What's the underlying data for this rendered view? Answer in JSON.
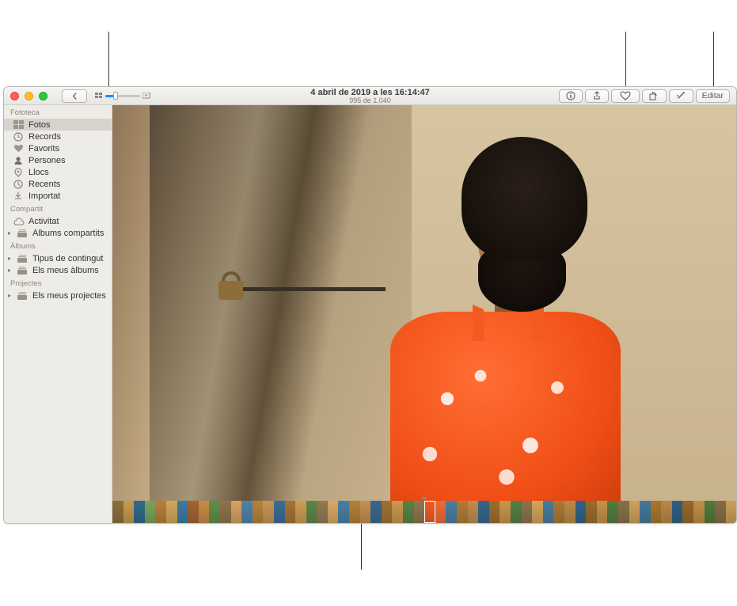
{
  "header": {
    "title": "4 abril de 2019 a les 16:14:47",
    "subtitle": "995 de 1.040",
    "edit_label": "Editar"
  },
  "sidebar": {
    "sections": [
      {
        "title": "Fototeca",
        "items": [
          {
            "label": "Fotos",
            "icon": "photos-icon",
            "selected": true
          },
          {
            "label": "Records",
            "icon": "memories-icon"
          },
          {
            "label": "Favorits",
            "icon": "heart-icon"
          },
          {
            "label": "Persones",
            "icon": "people-icon"
          },
          {
            "label": "Llocs",
            "icon": "places-icon"
          },
          {
            "label": "Recents",
            "icon": "recents-icon"
          },
          {
            "label": "Importat",
            "icon": "import-icon"
          }
        ]
      },
      {
        "title": "Compartit",
        "items": [
          {
            "label": "Activitat",
            "icon": "cloud-icon"
          },
          {
            "label": "Àlbums compartits",
            "icon": "album-icon",
            "disclosure": true
          }
        ]
      },
      {
        "title": "Àlbums",
        "items": [
          {
            "label": "Tipus de contingut",
            "icon": "album-icon",
            "disclosure": true
          },
          {
            "label": "Els meus àlbums",
            "icon": "album-icon",
            "disclosure": true
          }
        ]
      },
      {
        "title": "Projectes",
        "items": [
          {
            "label": "Els meus projectes",
            "icon": "album-icon",
            "disclosure": true
          }
        ]
      }
    ]
  },
  "filmstrip": {
    "count": 58,
    "selected_index": 29,
    "colors": [
      "#8a6f3d",
      "#c79a4e",
      "#2e6a8c",
      "#7aa35a",
      "#b97e3c",
      "#d4a85a",
      "#3d7aa6",
      "#a06432",
      "#c98b42",
      "#5e8f4a",
      "#90724c",
      "#d7a35e",
      "#4c83a8",
      "#b88338",
      "#c69755",
      "#3a6d94",
      "#a67336",
      "#cf9d52",
      "#5b8647",
      "#927951",
      "#d8aa62",
      "#4680a3",
      "#b57f35",
      "#c39050",
      "#376890",
      "#a1712f",
      "#cc984d",
      "#588344",
      "#8e764e",
      "#f05a22",
      "#ef6a34",
      "#4a7ea0",
      "#b27b33",
      "#c08d4c",
      "#34658c",
      "#9d6e2c",
      "#c9954a",
      "#557f41",
      "#8b734b",
      "#d3a55c",
      "#477c9d",
      "#af7830",
      "#bc8a49",
      "#316288",
      "#9a6b2a",
      "#c69247",
      "#527c3e",
      "#887048",
      "#cfa258",
      "#44789a",
      "#ac752d",
      "#b98746",
      "#2e5f84",
      "#976828",
      "#c28f44",
      "#4f793b",
      "#856d45",
      "#cc9f55"
    ]
  }
}
